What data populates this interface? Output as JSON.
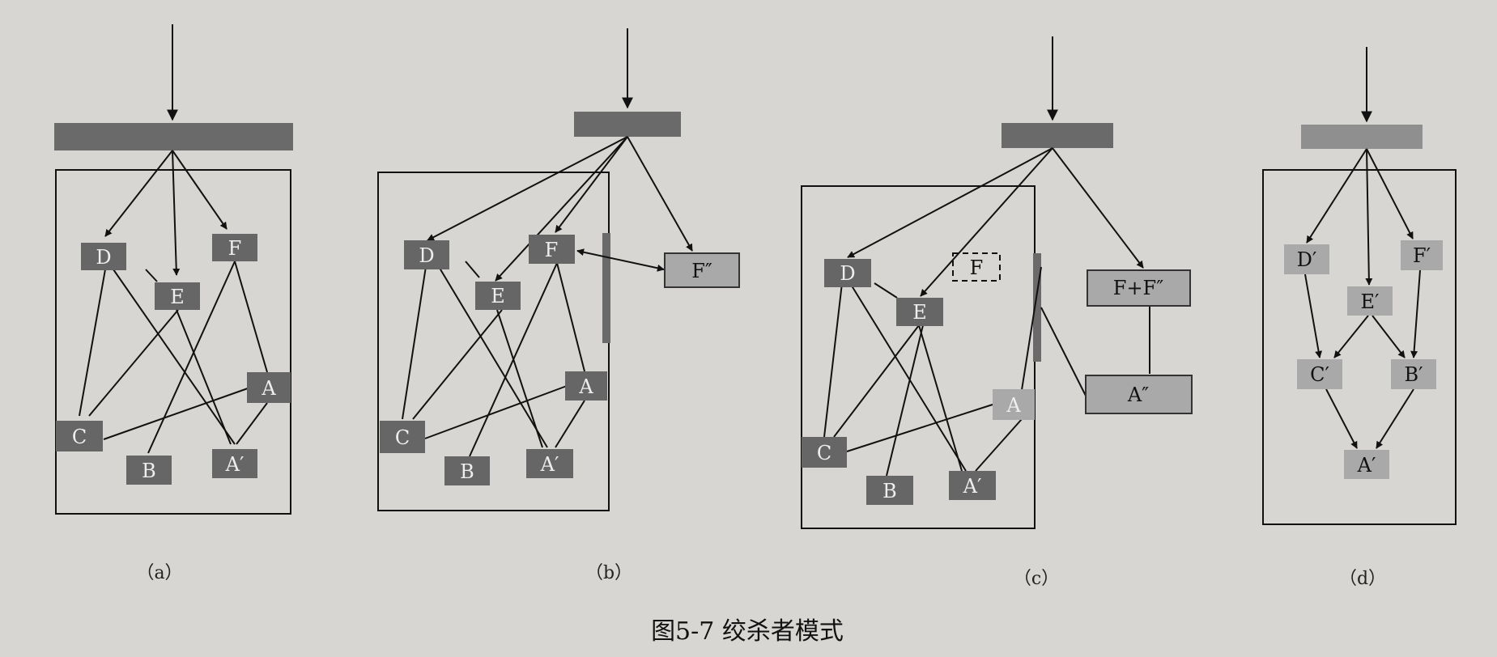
{
  "caption": "图5-7 绞杀者模式",
  "colors": {
    "background": "#d8d6d2",
    "bar": "#6a6a6a",
    "node_dark": "#666666",
    "node_light": "#a9a9a9",
    "line": "#111111"
  },
  "panels": [
    {
      "label": "（a）",
      "nodes": [
        {
          "id": "D",
          "text": "D"
        },
        {
          "id": "E",
          "text": "E"
        },
        {
          "id": "F",
          "text": "F"
        },
        {
          "id": "A",
          "text": "A"
        },
        {
          "id": "C",
          "text": "C"
        },
        {
          "id": "B",
          "text": "B"
        },
        {
          "id": "A2",
          "text": "A′"
        }
      ]
    },
    {
      "label": "（b）",
      "nodes": [
        {
          "id": "D",
          "text": "D"
        },
        {
          "id": "E",
          "text": "E"
        },
        {
          "id": "F",
          "text": "F"
        },
        {
          "id": "A",
          "text": "A"
        },
        {
          "id": "C",
          "text": "C"
        },
        {
          "id": "B",
          "text": "B"
        },
        {
          "id": "A2",
          "text": "A′"
        },
        {
          "id": "F2",
          "text": "F″"
        }
      ]
    },
    {
      "label": "（c）",
      "nodes": [
        {
          "id": "D",
          "text": "D"
        },
        {
          "id": "Fdash",
          "text": "F"
        },
        {
          "id": "E",
          "text": "E"
        },
        {
          "id": "A",
          "text": "A"
        },
        {
          "id": "C",
          "text": "C"
        },
        {
          "id": "B",
          "text": "B"
        },
        {
          "id": "A2",
          "text": "A′"
        },
        {
          "id": "FF",
          "text": "F+F″"
        },
        {
          "id": "A3",
          "text": "A″"
        }
      ]
    },
    {
      "label": "（d）",
      "nodes": [
        {
          "id": "D",
          "text": "D′"
        },
        {
          "id": "F",
          "text": "F′"
        },
        {
          "id": "E",
          "text": "E′"
        },
        {
          "id": "C",
          "text": "C′"
        },
        {
          "id": "B",
          "text": "B′"
        },
        {
          "id": "A",
          "text": "A′"
        }
      ]
    }
  ]
}
